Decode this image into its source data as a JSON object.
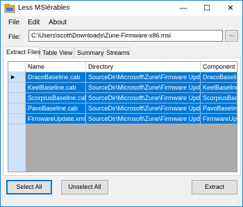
{
  "window": {
    "title": "Less MSIérables",
    "minimize": "—",
    "maximize": "☐",
    "close": "✕"
  },
  "menu": {
    "items": [
      "File",
      "Edit",
      "About"
    ]
  },
  "file": {
    "label": "File:",
    "path": "C:\\Users\\scott\\Downloads\\Zune-Firmware-x86.msi",
    "browse_label": "..."
  },
  "tabs": [
    {
      "label": "Extract Files",
      "active": true
    },
    {
      "label": "Table View",
      "active": false
    },
    {
      "label": "Summary",
      "active": false
    },
    {
      "label": "Streams",
      "active": false
    }
  ],
  "grid": {
    "columns": [
      "Name",
      "Directory",
      "Component"
    ],
    "rows": [
      {
        "name": "DracoBaseline.cab",
        "directory": "SourceDir\\Microsoft\\Zune\\Firmware Updates",
        "component": "DracoBaseline"
      },
      {
        "name": "KeelBaseline.cab",
        "directory": "SourceDir\\Microsoft\\Zune\\Firmware Updates",
        "component": "KeelBaselineC"
      },
      {
        "name": "ScorpiusBaseline.cab",
        "directory": "SourceDir\\Microsoft\\Zune\\Firmware Updates",
        "component": "ScorpiusBasel"
      },
      {
        "name": "PavoBaseline.cab",
        "directory": "SourceDir\\Microsoft\\Zune\\Firmware Updates",
        "component": "PavoBaseline"
      },
      {
        "name": "FirmwareUpdate.xml",
        "directory": "SourceDir\\Microsoft\\Zune\\Firmware Updates",
        "component": "FirmwareUpda"
      }
    ],
    "current_row_marker": "▶"
  },
  "buttons": {
    "select_all": "Select All",
    "unselect_all": "Unselect All",
    "extract": "Extract"
  },
  "colors": {
    "selection": "#0078d7",
    "window_border": "#1883d7",
    "grid_background": "#ababab"
  }
}
